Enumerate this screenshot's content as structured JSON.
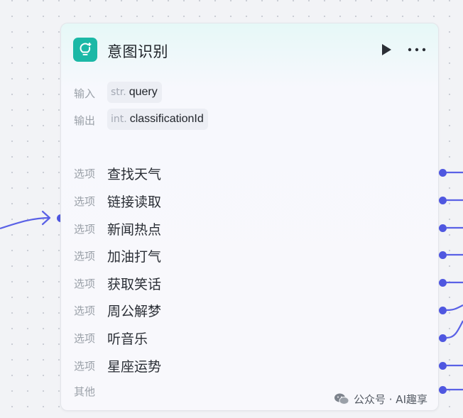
{
  "node": {
    "title": "意图识别",
    "icon": "lightbulb-icon",
    "accent_color": "#1bb8a6",
    "port_color": "#4f57e0",
    "input": {
      "label": "输入",
      "type": "str.",
      "name": "query"
    },
    "output": {
      "label": "输出",
      "type": "int.",
      "name": "classificationId"
    },
    "options": [
      {
        "label": "选项",
        "text": "查找天气"
      },
      {
        "label": "选项",
        "text": "链接读取"
      },
      {
        "label": "选项",
        "text": "新闻热点"
      },
      {
        "label": "选项",
        "text": "加油打气"
      },
      {
        "label": "选项",
        "text": "获取笑话"
      },
      {
        "label": "选项",
        "text": "周公解梦"
      },
      {
        "label": "选项",
        "text": "听音乐"
      },
      {
        "label": "选项",
        "text": "星座运势"
      }
    ],
    "other": {
      "label": "其他"
    }
  },
  "watermark": {
    "text": "公众号 · AI趣享",
    "icon": "wechat-icon"
  }
}
